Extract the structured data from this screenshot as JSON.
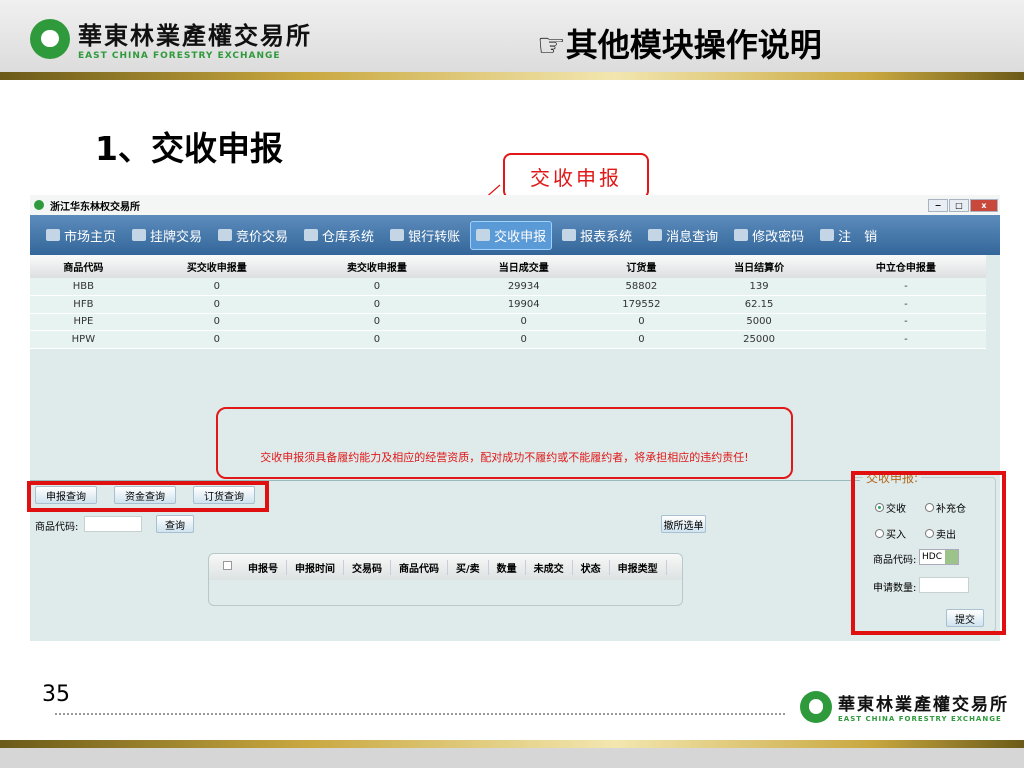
{
  "header": {
    "logo_cn": "華東林業產權交易所",
    "logo_en": "EAST CHINA FORESTRY EXCHANGE",
    "title": "☞其他模块操作说明"
  },
  "section_title": "1、交收申报",
  "callout": "交收申报",
  "app": {
    "window_title": "浙江华东林权交易所",
    "window_buttons": [
      "−",
      "□",
      "x"
    ],
    "nav": [
      {
        "label": "市场主页",
        "icon": "home-icon"
      },
      {
        "label": "挂牌交易",
        "icon": "folder-icon"
      },
      {
        "label": "竞价交易",
        "icon": "folder-icon"
      },
      {
        "label": "仓库系统",
        "icon": "warehouse-icon"
      },
      {
        "label": "银行转账",
        "icon": "bank-icon"
      },
      {
        "label": "交收申报",
        "icon": "folder-icon",
        "active": true
      },
      {
        "label": "报表系统",
        "icon": "folder-icon"
      },
      {
        "label": "消息查询",
        "icon": "message-icon"
      },
      {
        "label": "修改密码",
        "icon": "tools-icon"
      },
      {
        "label": "注　销",
        "icon": "logout-icon"
      }
    ],
    "table": {
      "headers": [
        "商品代码",
        "买交收申报量",
        "卖交收申报量",
        "当日成交量",
        "订货量",
        "当日结算价",
        "中立仓申报量"
      ],
      "rows": [
        [
          "HBB",
          "0",
          "0",
          "29934",
          "58802",
          "139",
          "-"
        ],
        [
          "HFB",
          "0",
          "0",
          "19904",
          "179552",
          "62.15",
          "-"
        ],
        [
          "HPE",
          "0",
          "0",
          "0",
          "0",
          "5000",
          "-"
        ],
        [
          "HPW",
          "0",
          "0",
          "0",
          "0",
          "25000",
          "-"
        ]
      ]
    },
    "notice": "交收申报须具备履约能力及相应的经营资质，配对成功不履约或不能履约者，将承担相应的违约责任!",
    "query_tabs": [
      "申报查询",
      "资金查询",
      "订货查询"
    ],
    "query": {
      "code_label": "商品代码:",
      "code_value": "",
      "search_button": "查询",
      "cancel_button": "撤所选单"
    },
    "sub_table_headers": [
      "申报号",
      "申报时间",
      "交易码",
      "商品代码",
      "买/卖",
      "数量",
      "未成交",
      "状态",
      "申报类型"
    ],
    "form": {
      "title": "交收申报:",
      "type_options": [
        "交收",
        "补充仓"
      ],
      "type_selected": "交收",
      "side_options": [
        "买入",
        "卖出"
      ],
      "code_label": "商品代码:",
      "code_value": "HDC",
      "qty_label": "申请数量:",
      "qty_value": "",
      "submit": "提交"
    }
  },
  "footer": {
    "page": "35",
    "logo_cn": "華東林業產權交易所",
    "logo_en": "EAST CHINA FORESTRY EXCHANGE"
  },
  "colors": {
    "highlight": "#e01818",
    "nav": "#3f73a8",
    "logo_green": "#2f9a3c"
  }
}
